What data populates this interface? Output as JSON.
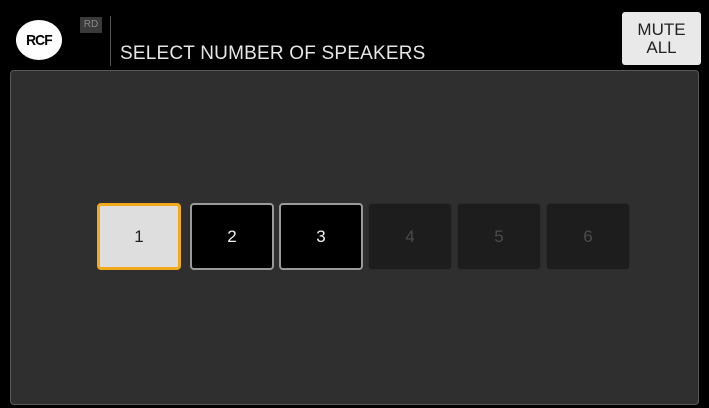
{
  "header": {
    "logo_text": "RCF",
    "badge": "RD",
    "title": "SELECT NUMBER OF SPEAKERS",
    "mute_button": {
      "line1": "MUTE",
      "line2": "ALL"
    }
  },
  "speakers": {
    "selected": 1,
    "buttons": [
      {
        "label": "1",
        "state": "selected"
      },
      {
        "label": "2",
        "state": "available"
      },
      {
        "label": "3",
        "state": "available"
      },
      {
        "label": "4",
        "state": "disabled"
      },
      {
        "label": "5",
        "state": "disabled"
      },
      {
        "label": "6",
        "state": "disabled"
      }
    ]
  },
  "colors": {
    "accent_selected_border": "#f2a91a",
    "panel_background": "#2f2f2f",
    "header_background": "#000000"
  }
}
